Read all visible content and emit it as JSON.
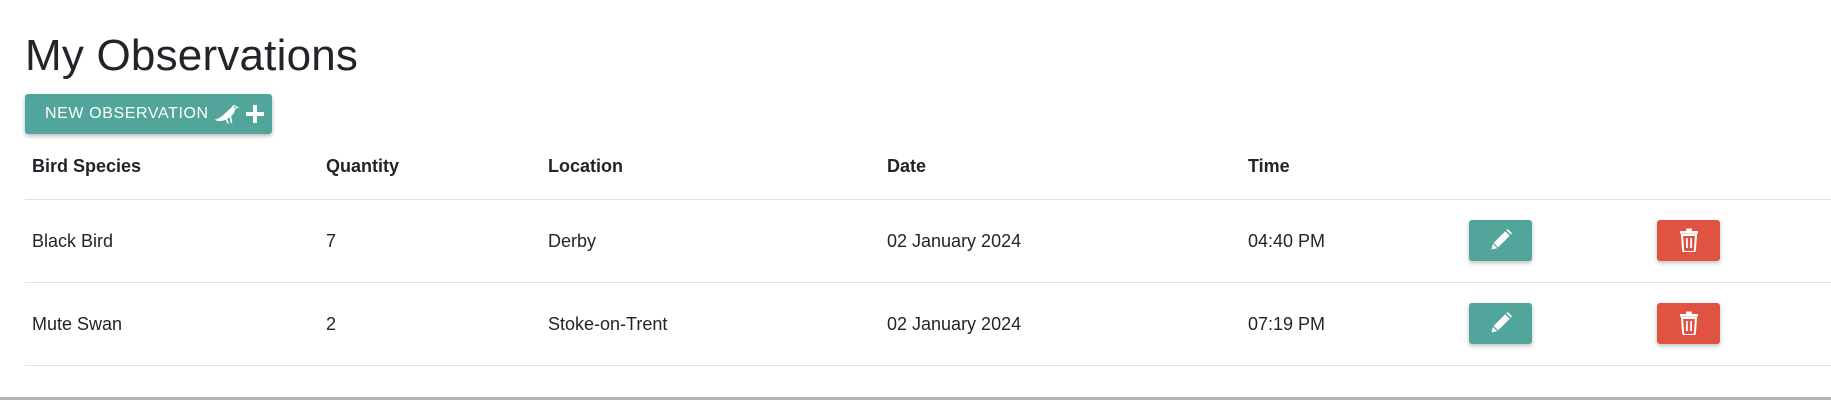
{
  "page": {
    "title": "My Observations",
    "new_button_label": "New Observation",
    "new_button_icons": [
      "bird-icon",
      "plus-icon"
    ]
  },
  "table": {
    "headers": [
      "Bird Species",
      "Quantity",
      "Location",
      "Date",
      "Time"
    ],
    "rows": [
      {
        "species": "Black Bird",
        "quantity": "7",
        "location": "Derby",
        "date": "02 January 2024",
        "time": "04:40 PM"
      },
      {
        "species": "Mute Swan",
        "quantity": "2",
        "location": "Stoke-on-Trent",
        "date": "02 January 2024",
        "time": "07:19 PM"
      }
    ],
    "row_actions": [
      {
        "icon": "pencil-icon",
        "color": "#52a59a"
      },
      {
        "icon": "trash-icon",
        "color": "#e05342"
      }
    ]
  },
  "colors": {
    "accent": "#52a59a",
    "danger": "#e05342",
    "text": "#212529",
    "divider": "#dee2e6"
  }
}
